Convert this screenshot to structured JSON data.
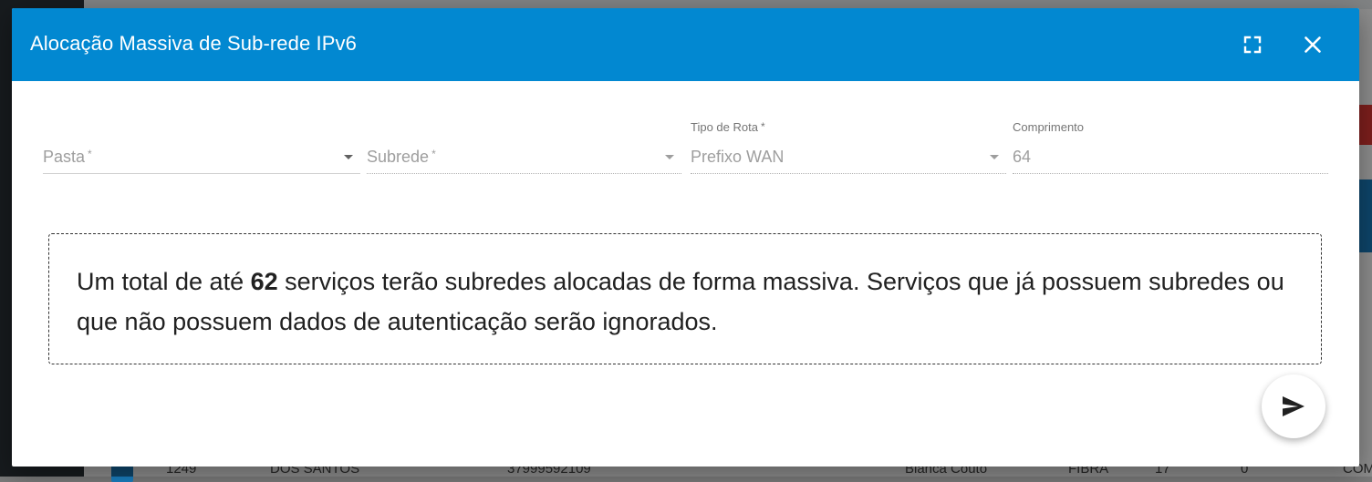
{
  "dialog": {
    "title": "Alocação Massiva de Sub-rede IPv6",
    "fullscreen_icon": "fullscreen-icon",
    "close_icon": "close-icon"
  },
  "fields": {
    "pasta": {
      "placeholder": "Pasta",
      "required_mark": "*"
    },
    "subrede": {
      "placeholder": "Subrede",
      "required_mark": "*"
    },
    "tipo_rota": {
      "label": "Tipo de Rota",
      "required_mark": "*",
      "value": "Prefixo WAN"
    },
    "comprimento": {
      "label": "Comprimento",
      "value": "64"
    }
  },
  "info": {
    "prefix": "Um total de até ",
    "count": "62",
    "suffix": " serviços terão subredes alocadas de forma massiva. Serviços que já possuem subredes ou que não possuem dados de autenticação serão ignorados."
  },
  "send_button": {
    "icon": "send-icon"
  },
  "background_row": {
    "id": "1249",
    "name": "DOS SANTOS",
    "phone": "37999592109",
    "user": "Bianca Couto",
    "tech": "FIBRA",
    "n1": "17",
    "n2": "0",
    "status": "COM"
  },
  "colors": {
    "header": "#0288d1",
    "background_dim": "rgba(0,0,0,0.45)"
  }
}
